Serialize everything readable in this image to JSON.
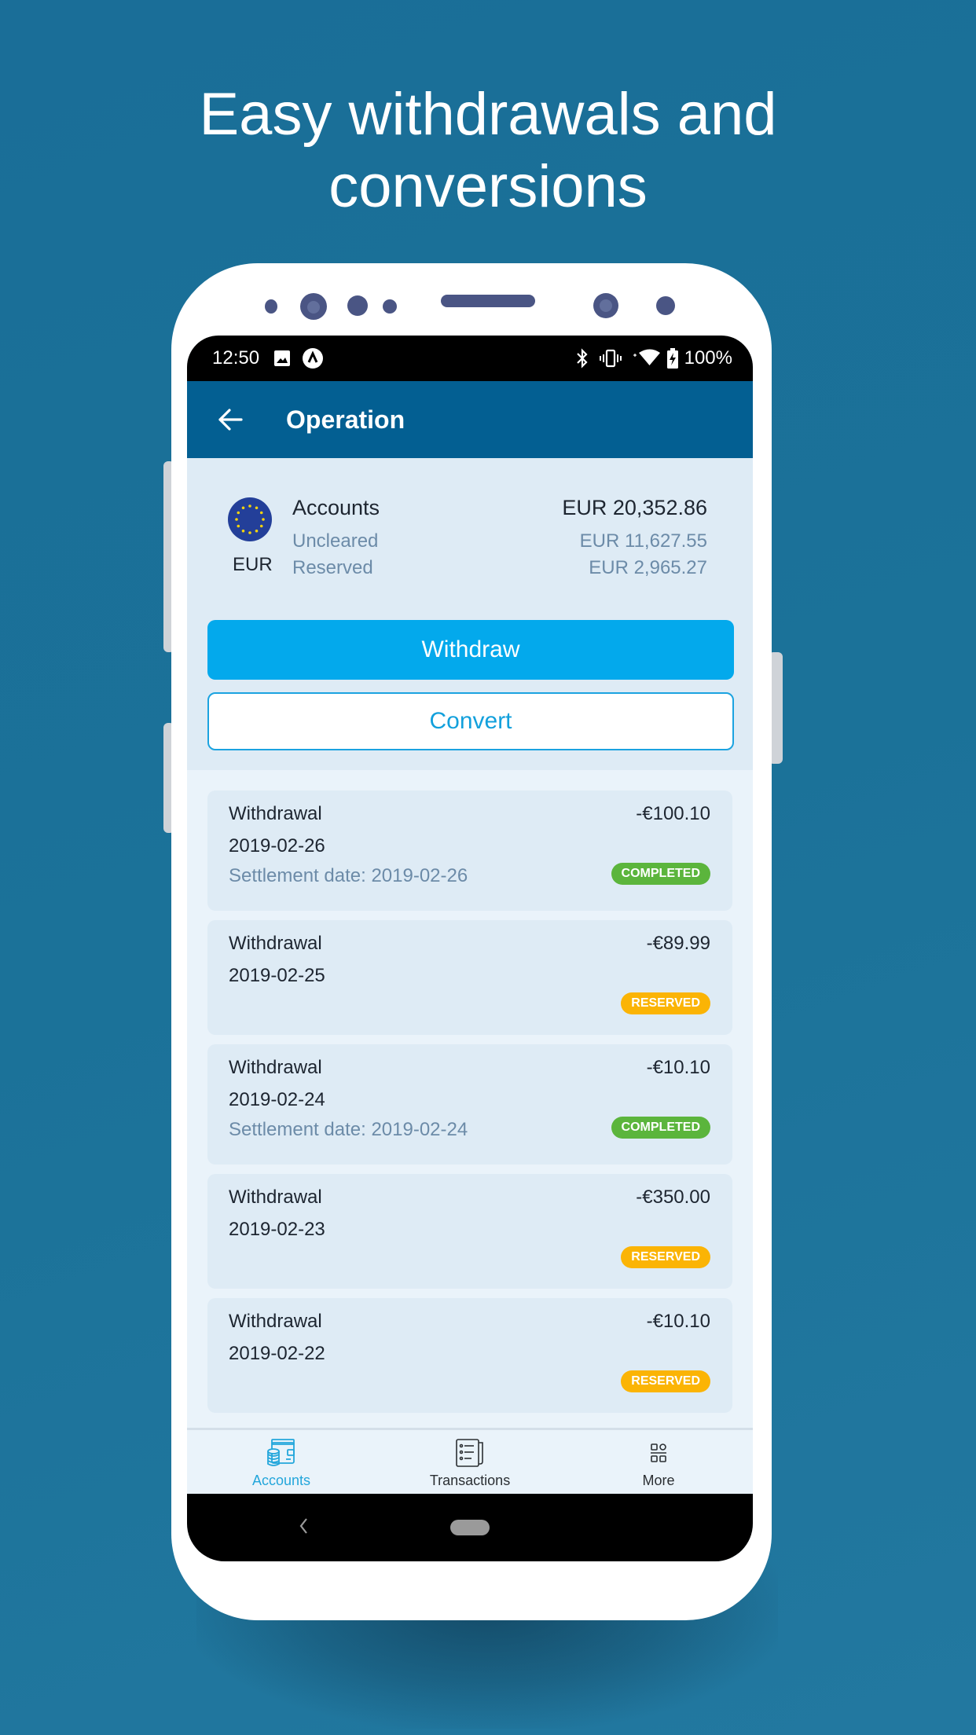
{
  "headline": {
    "line1": "Easy withdrawals and",
    "line2": "conversions"
  },
  "status_bar": {
    "time": "12:50",
    "battery": "100%",
    "left_icons": [
      "image-icon",
      "app-notification-icon"
    ],
    "right_icons": [
      "bluetooth-icon",
      "vibrate-icon",
      "wifi-icon",
      "battery-charging-icon"
    ]
  },
  "app_bar": {
    "title": "Operation",
    "back_icon": "arrow-left-icon"
  },
  "account": {
    "currency": "EUR",
    "flag_icon": "eu-flag-icon",
    "name": "Accounts",
    "total": "EUR 20,352.86",
    "uncleared_label": "Uncleared",
    "uncleared_value": "EUR 11,627.55",
    "reserved_label": "Reserved",
    "reserved_value": "EUR 2,965.27"
  },
  "actions": {
    "withdraw": "Withdraw",
    "convert": "Convert"
  },
  "transactions": [
    {
      "type": "Withdrawal",
      "amount": "-€100.10",
      "date": "2019-02-26",
      "settlement": "Settlement date: 2019-02-26",
      "status": "COMPLETED"
    },
    {
      "type": "Withdrawal",
      "amount": "-€89.99",
      "date": "2019-02-25",
      "settlement": "",
      "status": "RESERVED"
    },
    {
      "type": "Withdrawal",
      "amount": "-€10.10",
      "date": "2019-02-24",
      "settlement": "Settlement date: 2019-02-24",
      "status": "COMPLETED"
    },
    {
      "type": "Withdrawal",
      "amount": "-€350.00",
      "date": "2019-02-23",
      "settlement": "",
      "status": "RESERVED"
    },
    {
      "type": "Withdrawal",
      "amount": "-€10.10",
      "date": "2019-02-22",
      "settlement": "",
      "status": "RESERVED"
    }
  ],
  "bottom_nav": [
    {
      "label": "Accounts",
      "icon": "wallet-coins-icon",
      "active": true
    },
    {
      "label": "Transactions",
      "icon": "receipt-list-icon",
      "active": false
    },
    {
      "label": "More",
      "icon": "grid-more-icon",
      "active": false
    }
  ],
  "colors": {
    "background": "#1b7299",
    "app_bar": "#035f92",
    "primary_button": "#03a9ec",
    "completed": "#5bb53c",
    "reserved": "#fbb405",
    "active_nav": "#23a6db"
  }
}
